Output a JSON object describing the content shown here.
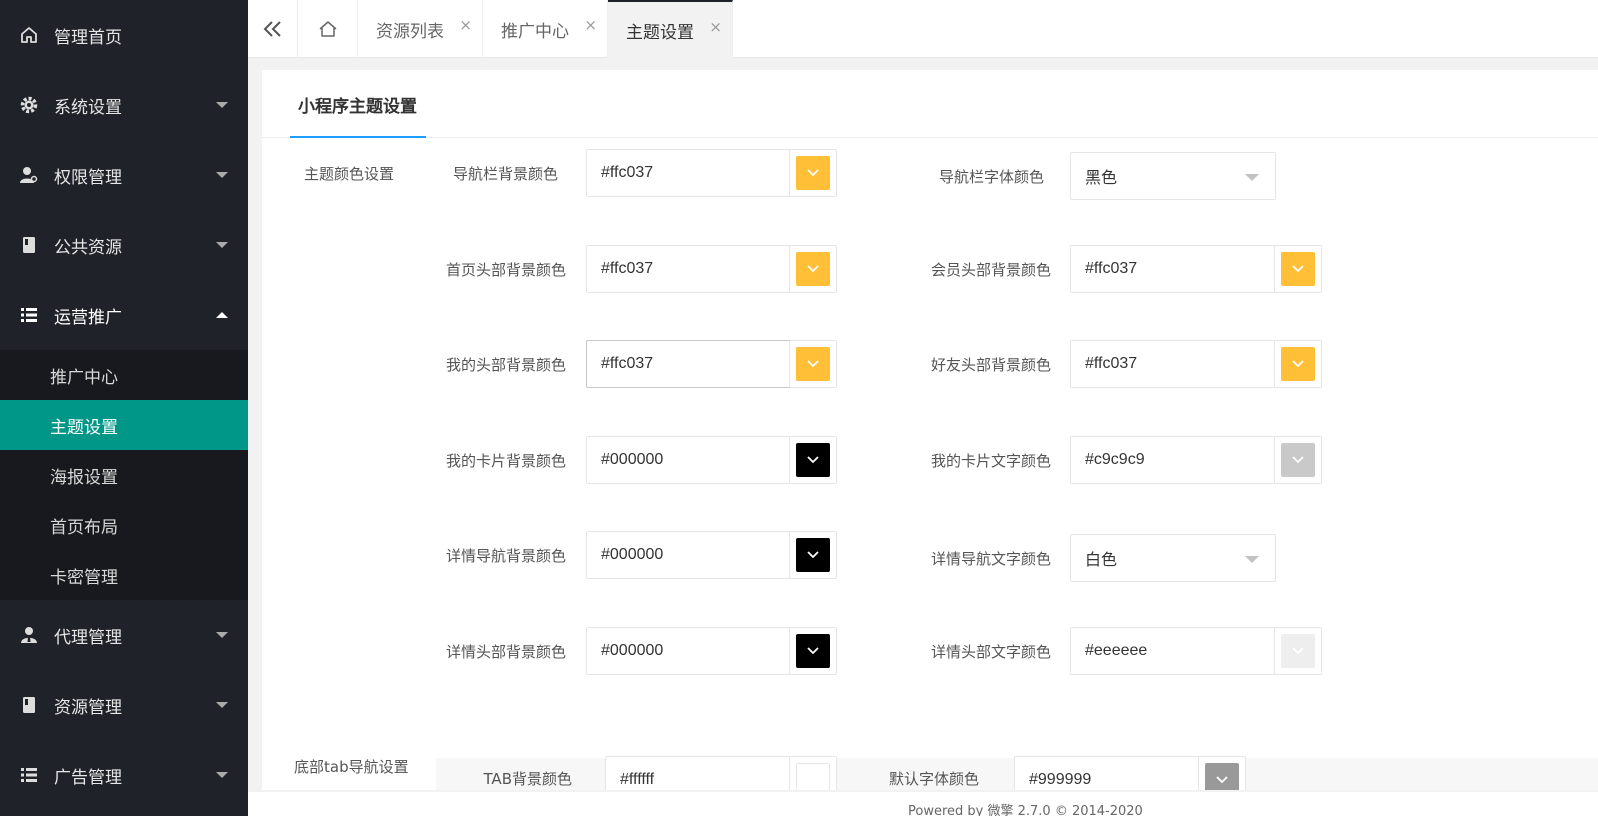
{
  "sidebar": {
    "items": [
      {
        "label": "管理首页"
      },
      {
        "label": "系统设置"
      },
      {
        "label": "权限管理"
      },
      {
        "label": "公共资源"
      },
      {
        "label": "运营推广"
      },
      {
        "label": "代理管理"
      },
      {
        "label": "资源管理"
      },
      {
        "label": "广告管理"
      }
    ],
    "submenu": [
      {
        "label": "推广中心"
      },
      {
        "label": "主题设置"
      },
      {
        "label": "海报设置"
      },
      {
        "label": "首页布局"
      },
      {
        "label": "卡密管理"
      }
    ]
  },
  "tabs": [
    {
      "label": "资源列表"
    },
    {
      "label": "推广中心"
    },
    {
      "label": "主题设置"
    }
  ],
  "tab_close": "×",
  "card": {
    "title": "小程序主题设置",
    "section_theme": "主题颜色设置",
    "section_tab": "底部tab导航设置"
  },
  "fields": {
    "nav_bg": {
      "label": "导航栏背景颜色",
      "value": "#ffc037",
      "color": "#ffc037"
    },
    "nav_font": {
      "label": "导航栏字体颜色",
      "value": "黑色"
    },
    "home_head_bg": {
      "label": "首页头部背景颜色",
      "value": "#ffc037",
      "color": "#ffc037"
    },
    "member_head_bg": {
      "label": "会员头部背景颜色",
      "value": "#ffc037",
      "color": "#ffc037"
    },
    "my_head_bg": {
      "label": "我的头部背景颜色",
      "value": "#ffc037",
      "color": "#ffc037"
    },
    "friend_head_bg": {
      "label": "好友头部背景颜色",
      "value": "#ffc037",
      "color": "#ffc037"
    },
    "my_card_bg": {
      "label": "我的卡片背景颜色",
      "value": "#000000",
      "color": "#000000"
    },
    "my_card_text": {
      "label": "我的卡片文字颜色",
      "value": "#c9c9c9",
      "color": "#c9c9c9"
    },
    "detail_nav_bg": {
      "label": "详情导航背景颜色",
      "value": "#000000",
      "color": "#000000"
    },
    "detail_nav_text": {
      "label": "详情导航文字颜色",
      "value": "白色"
    },
    "detail_head_bg": {
      "label": "详情头部背景颜色",
      "value": "#000000",
      "color": "#000000"
    },
    "detail_head_text": {
      "label": "详情头部文字颜色",
      "value": "#eeeeee",
      "color": "#eeeeee"
    },
    "tab_bg": {
      "label": "TAB背景颜色",
      "value": "#ffffff",
      "color": "#ffffff"
    },
    "default_font": {
      "label": "默认字体颜色",
      "value": "#999999",
      "color": "#999999"
    }
  },
  "footer": {
    "text": "Powered by 微擎 2.7.0 © 2014-2020"
  }
}
